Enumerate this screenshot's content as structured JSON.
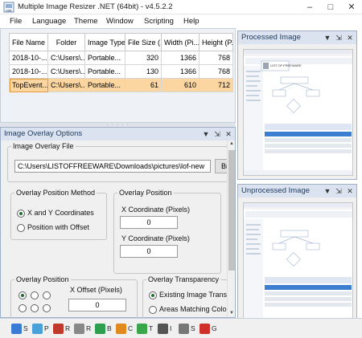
{
  "window": {
    "title": "Multiple Image Resizer .NET (64bit) - v4.5.2.2",
    "icon_label": "MIR",
    "buttons": [
      "–",
      "□",
      "✕"
    ]
  },
  "menu": [
    "File",
    "Language",
    "Theme",
    "Window",
    "Scripting",
    "Help"
  ],
  "files_table": {
    "columns": [
      "File Name",
      "Folder",
      "Image Type",
      "File Size (...",
      "Width (Pi...",
      "Height (P..."
    ],
    "rows": [
      [
        "2018-10-...",
        "C:\\Users\\...",
        "Portable...",
        "320",
        "1366",
        "768"
      ],
      [
        "2018-10-...",
        "C:\\Users\\...",
        "Portable...",
        "130",
        "1366",
        "768"
      ],
      [
        "TopEvent...",
        "C:\\Users\\...",
        "Portable...",
        "61",
        "610",
        "712"
      ]
    ],
    "selected_row": 2
  },
  "overlay_panel": {
    "title": "Image Overlay Options",
    "file_group": {
      "legend": "Image Overlay File",
      "path": "C:\\Users\\LISTOFFREEWARE\\Downloads\\pictures\\lof-new",
      "browse": "Bro"
    },
    "method_group": {
      "legend": "Overlay Position Method",
      "options": [
        "X and Y Coordinates",
        "Position with Offset"
      ],
      "selected": 0
    },
    "position_group": {
      "legend": "Overlay Position",
      "x_label": "X Coordinate (Pixels)",
      "x_value": "0",
      "y_label": "Y Coordinate (Pixels)",
      "y_value": "0"
    },
    "overlay_position_group": {
      "legend": "Overlay Position",
      "x_offset_label": "X Offset (Pixels)",
      "x_offset_value": "0"
    },
    "transparency_group": {
      "legend": "Overlay Transparency",
      "options": [
        "Existing Image Transpa",
        "Areas Matching Colour"
      ],
      "selected": 0
    }
  },
  "processed_panel": {
    "title": "Processed Image"
  },
  "unprocessed_panel": {
    "title": "Unprocessed Image"
  },
  "thumbnail": {
    "window_title": "MIR Multiple Image Resizer",
    "overlay_text": "LIST OF FREEWARE"
  },
  "toolbar": [
    {
      "letter": "S",
      "color": "#3a7bd5"
    },
    {
      "letter": "P",
      "color": "#4aa0d8"
    },
    {
      "letter": "R",
      "color": "#c0392b"
    },
    {
      "letter": "R",
      "color": "#888888"
    },
    {
      "letter": "B",
      "color": "#2e9e4f"
    },
    {
      "letter": "C",
      "color": "#e08a1e"
    },
    {
      "letter": "T",
      "color": "#3aa64a"
    },
    {
      "letter": "I",
      "color": "#555555"
    },
    {
      "letter": "S",
      "color": "#777777"
    },
    {
      "letter": "G",
      "color": "#d0302a"
    }
  ],
  "colors": {
    "selection": "#fbd6a0",
    "panel_header": "#dae3ef",
    "radio_dot": "#1f6f2a"
  }
}
